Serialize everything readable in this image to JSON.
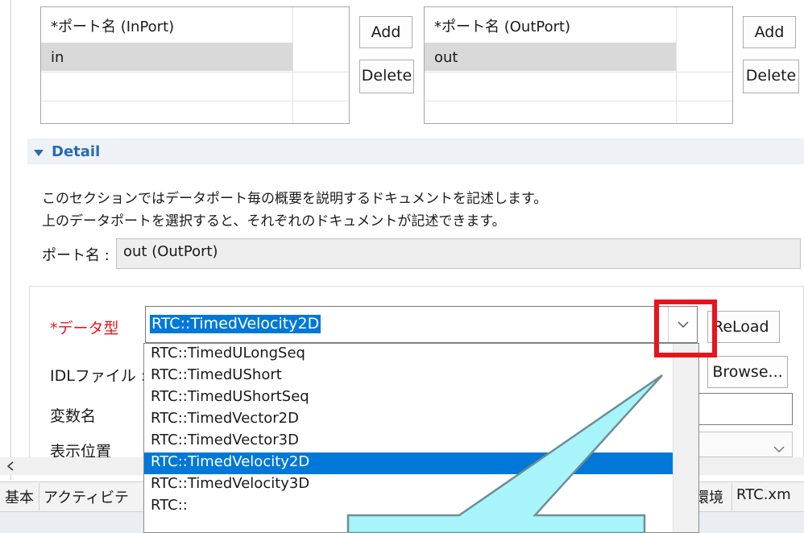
{
  "inport": {
    "header": "*ポート名 (InPort)",
    "rows": [
      "in"
    ],
    "add_label": "Add",
    "delete_label": "Delete"
  },
  "outport": {
    "header": "*ポート名 (OutPort)",
    "rows": [
      "out"
    ],
    "add_label": "Add",
    "delete_label": "Delete"
  },
  "detail": {
    "title": "Detail",
    "description_line1": "このセクションではデータポート毎の概要を説明するドキュメントを記述します。",
    "description_line2": "上のデータポートを選択すると、それぞれのドキュメントが記述できます。",
    "port_name_label": "ポート名 :",
    "port_name_value": "out (OutPort)"
  },
  "form": {
    "datatype_label": "*データ型",
    "datatype_value": "RTC::TimedVelocity2D",
    "reload_label": "ReLoad",
    "idl_label": "IDLファイル :",
    "browse_label": "Browse...",
    "varname_label": "変数名",
    "position_label": "表示位置"
  },
  "dropdown": {
    "items": [
      "RTC::TimedULongSeq",
      "RTC::TimedUShort",
      "RTC::TimedUShortSeq",
      "RTC::TimedVector2D",
      "RTC::TimedVector3D",
      "RTC::TimedVelocity2D",
      "RTC::TimedVelocity3D",
      "RTC::"
    ],
    "selected_index": 5
  },
  "tabs": [
    "基本",
    "アクティビテ",
    "環境",
    "RTC.xm"
  ],
  "colors": {
    "accent_blue": "#0078d7",
    "section_title": "#276bb3",
    "required_label": "#e8141c",
    "highlight_box": "#e8141c",
    "callout_fill": "#a7f5fb"
  }
}
